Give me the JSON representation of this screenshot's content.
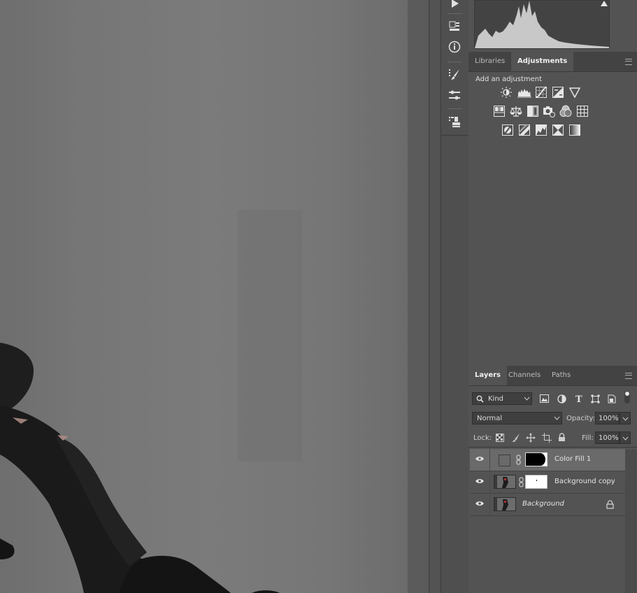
{
  "adjustments_panel": {
    "tabs": [
      "Libraries",
      "Adjustments"
    ],
    "active_tab": "Adjustments",
    "header": "Add an adjustment"
  },
  "layers_panel": {
    "tabs": [
      "Layers",
      "Channels",
      "Paths"
    ],
    "active_tab": "Layers",
    "filter_kind": "Kind",
    "blend_mode": "Normal",
    "opacity_label": "Opacity:",
    "opacity_value": "100%",
    "lock_label": "Lock:",
    "fill_label": "Fill:",
    "fill_value": "100%",
    "layers": [
      {
        "name": "Color Fill 1",
        "visible": true,
        "selected": true
      },
      {
        "name": "Background copy",
        "visible": true,
        "selected": false
      },
      {
        "name": "Background",
        "visible": true,
        "selected": false,
        "locked": true
      }
    ]
  },
  "colors": {
    "panel_bg": "#535353",
    "tab_bar_bg": "#434343",
    "selected_layer": "#6a6a6a"
  }
}
